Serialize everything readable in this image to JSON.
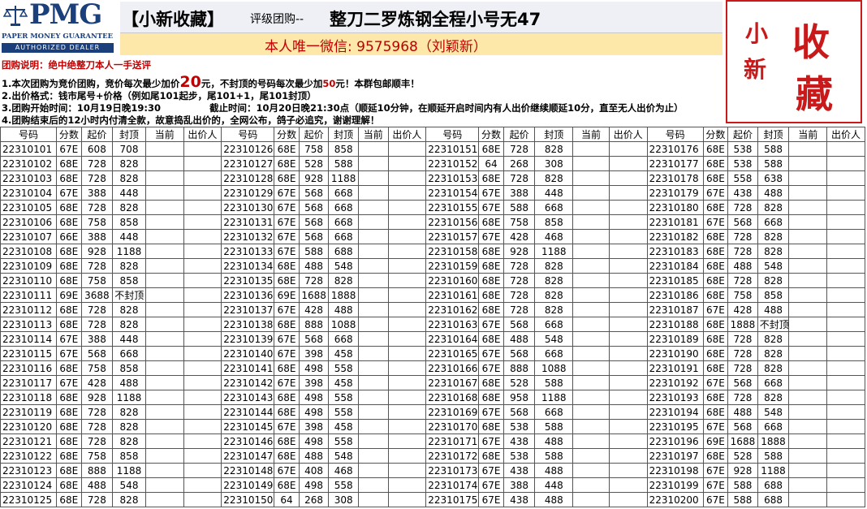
{
  "logo": {
    "word": "PMG",
    "line1": "PAPER MONEY GUARANTEE",
    "line2": "AUTHORIZED DEALER"
  },
  "title": {
    "brand": "【小新收藏】",
    "sub": "评级团购--",
    "main": "整刀二罗炼钢全程小号无47"
  },
  "wechat": "本人唯一微信: 9575968（刘颖新）",
  "seal": {
    "chars": [
      "小",
      "新",
      "收",
      "藏"
    ]
  },
  "notes": {
    "l1": "团购说明：绝中绝整刀本人一手送评",
    "l2a": "1.本次团购为竞价团购，竞价每次最少加价",
    "l2b": "20",
    "l2c": "元，不封顶的号码每次最少加",
    "l2d": "50",
    "l2e": "元！本群包邮顺丰！",
    "l3": "2.出价格式：钱市尾号+价格（例如尾101起步，尾101+1，尾101封顶）",
    "l4a": "3.团购开始时间：10月19日晚19:30",
    "l4b": "截止时间：10月20日晚21:30点（顺延10分钟，在顺延开启时间内有人出价继续顺延10分，直至无人出价为止）",
    "l5": "4.团购结束后的12小时内付清全款，故意捣乱出价的，全网公布，鸽子必追究，谢谢理解！"
  },
  "table": {
    "headers": [
      "号码",
      "分数",
      "起价",
      "封顶",
      "当前",
      "出价人"
    ],
    "rows": [
      [
        [
          "22310101",
          "67E",
          "608",
          "708"
        ],
        [
          "22310126",
          "68E",
          "758",
          "858"
        ],
        [
          "22310151",
          "68E",
          "728",
          "828"
        ],
        [
          "22310176",
          "68E",
          "538",
          "588"
        ]
      ],
      [
        [
          "22310102",
          "68E",
          "728",
          "828"
        ],
        [
          "22310127",
          "68E",
          "528",
          "588"
        ],
        [
          "22310152",
          "64",
          "268",
          "308"
        ],
        [
          "22310177",
          "68E",
          "538",
          "588"
        ]
      ],
      [
        [
          "22310103",
          "68E",
          "728",
          "828"
        ],
        [
          "22310128",
          "68E",
          "928",
          "1188"
        ],
        [
          "22310153",
          "68E",
          "728",
          "828"
        ],
        [
          "22310178",
          "68E",
          "558",
          "638"
        ]
      ],
      [
        [
          "22310104",
          "67E",
          "388",
          "448"
        ],
        [
          "22310129",
          "67E",
          "568",
          "668"
        ],
        [
          "22310154",
          "67E",
          "388",
          "448"
        ],
        [
          "22310179",
          "67E",
          "438",
          "488"
        ]
      ],
      [
        [
          "22310105",
          "68E",
          "728",
          "828"
        ],
        [
          "22310130",
          "67E",
          "568",
          "668"
        ],
        [
          "22310155",
          "67E",
          "588",
          "668"
        ],
        [
          "22310180",
          "68E",
          "728",
          "828"
        ]
      ],
      [
        [
          "22310106",
          "68E",
          "758",
          "858"
        ],
        [
          "22310131",
          "67E",
          "568",
          "668"
        ],
        [
          "22310156",
          "68E",
          "758",
          "858"
        ],
        [
          "22310181",
          "67E",
          "568",
          "668"
        ]
      ],
      [
        [
          "22310107",
          "66E",
          "388",
          "448"
        ],
        [
          "22310132",
          "67E",
          "568",
          "668"
        ],
        [
          "22310157",
          "67E",
          "428",
          "468"
        ],
        [
          "22310182",
          "68E",
          "728",
          "828"
        ]
      ],
      [
        [
          "22310108",
          "68E",
          "928",
          "1188"
        ],
        [
          "22310133",
          "67E",
          "588",
          "688"
        ],
        [
          "22310158",
          "68E",
          "928",
          "1188"
        ],
        [
          "22310183",
          "68E",
          "728",
          "828"
        ]
      ],
      [
        [
          "22310109",
          "68E",
          "728",
          "828"
        ],
        [
          "22310134",
          "68E",
          "488",
          "548"
        ],
        [
          "22310159",
          "68E",
          "728",
          "828"
        ],
        [
          "22310184",
          "68E",
          "488",
          "548"
        ]
      ],
      [
        [
          "22310110",
          "68E",
          "758",
          "858"
        ],
        [
          "22310135",
          "68E",
          "728",
          "828"
        ],
        [
          "22310160",
          "68E",
          "728",
          "828"
        ],
        [
          "22310185",
          "68E",
          "728",
          "828"
        ]
      ],
      [
        [
          "22310111",
          "69E",
          "3688",
          "不封顶"
        ],
        [
          "22310136",
          "69E",
          "1688",
          "1888"
        ],
        [
          "22310161",
          "68E",
          "728",
          "828"
        ],
        [
          "22310186",
          "68E",
          "758",
          "858"
        ]
      ],
      [
        [
          "22310112",
          "68E",
          "728",
          "828"
        ],
        [
          "22310137",
          "67E",
          "428",
          "488"
        ],
        [
          "22310162",
          "68E",
          "728",
          "828"
        ],
        [
          "22310187",
          "67E",
          "428",
          "488"
        ]
      ],
      [
        [
          "22310113",
          "68E",
          "728",
          "828"
        ],
        [
          "22310138",
          "68E",
          "888",
          "1088"
        ],
        [
          "22310163",
          "67E",
          "568",
          "668"
        ],
        [
          "22310188",
          "68E",
          "1888",
          "不封顶"
        ]
      ],
      [
        [
          "22310114",
          "67E",
          "388",
          "448"
        ],
        [
          "22310139",
          "67E",
          "568",
          "668"
        ],
        [
          "22310164",
          "68E",
          "488",
          "548"
        ],
        [
          "22310189",
          "68E",
          "728",
          "828"
        ]
      ],
      [
        [
          "22310115",
          "67E",
          "568",
          "668"
        ],
        [
          "22310140",
          "67E",
          "398",
          "458"
        ],
        [
          "22310165",
          "67E",
          "568",
          "668"
        ],
        [
          "22310190",
          "68E",
          "728",
          "828"
        ]
      ],
      [
        [
          "22310116",
          "68E",
          "758",
          "858"
        ],
        [
          "22310141",
          "68E",
          "498",
          "558"
        ],
        [
          "22310166",
          "67E",
          "888",
          "1088"
        ],
        [
          "22310191",
          "68E",
          "728",
          "828"
        ]
      ],
      [
        [
          "22310117",
          "67E",
          "428",
          "488"
        ],
        [
          "22310142",
          "67E",
          "398",
          "458"
        ],
        [
          "22310167",
          "68E",
          "528",
          "588"
        ],
        [
          "22310192",
          "67E",
          "568",
          "668"
        ]
      ],
      [
        [
          "22310118",
          "68E",
          "928",
          "1188"
        ],
        [
          "22310143",
          "68E",
          "498",
          "558"
        ],
        [
          "22310168",
          "68E",
          "958",
          "1188"
        ],
        [
          "22310193",
          "68E",
          "728",
          "828"
        ]
      ],
      [
        [
          "22310119",
          "68E",
          "728",
          "828"
        ],
        [
          "22310144",
          "68E",
          "498",
          "558"
        ],
        [
          "22310169",
          "67E",
          "568",
          "668"
        ],
        [
          "22310194",
          "68E",
          "488",
          "548"
        ]
      ],
      [
        [
          "22310120",
          "68E",
          "728",
          "828"
        ],
        [
          "22310145",
          "67E",
          "398",
          "458"
        ],
        [
          "22310170",
          "68E",
          "538",
          "588"
        ],
        [
          "22310195",
          "67E",
          "568",
          "668"
        ]
      ],
      [
        [
          "22310121",
          "68E",
          "728",
          "828"
        ],
        [
          "22310146",
          "68E",
          "498",
          "558"
        ],
        [
          "22310171",
          "67E",
          "438",
          "488"
        ],
        [
          "22310196",
          "69E",
          "1688",
          "1888"
        ]
      ],
      [
        [
          "22310122",
          "68E",
          "758",
          "858"
        ],
        [
          "22310147",
          "68E",
          "488",
          "548"
        ],
        [
          "22310172",
          "68E",
          "538",
          "588"
        ],
        [
          "22310197",
          "68E",
          "528",
          "588"
        ]
      ],
      [
        [
          "22310123",
          "68E",
          "888",
          "1188"
        ],
        [
          "22310148",
          "67E",
          "408",
          "468"
        ],
        [
          "22310173",
          "67E",
          "438",
          "488"
        ],
        [
          "22310198",
          "67E",
          "928",
          "1188"
        ]
      ],
      [
        [
          "22310124",
          "68E",
          "488",
          "548"
        ],
        [
          "22310149",
          "68E",
          "498",
          "558"
        ],
        [
          "22310174",
          "67E",
          "388",
          "448"
        ],
        [
          "22310199",
          "67E",
          "588",
          "688"
        ]
      ],
      [
        [
          "22310125",
          "68E",
          "728",
          "828"
        ],
        [
          "22310150",
          "64",
          "268",
          "308"
        ],
        [
          "22310175",
          "67E",
          "438",
          "488"
        ],
        [
          "22310200",
          "67E",
          "588",
          "688"
        ]
      ]
    ]
  }
}
